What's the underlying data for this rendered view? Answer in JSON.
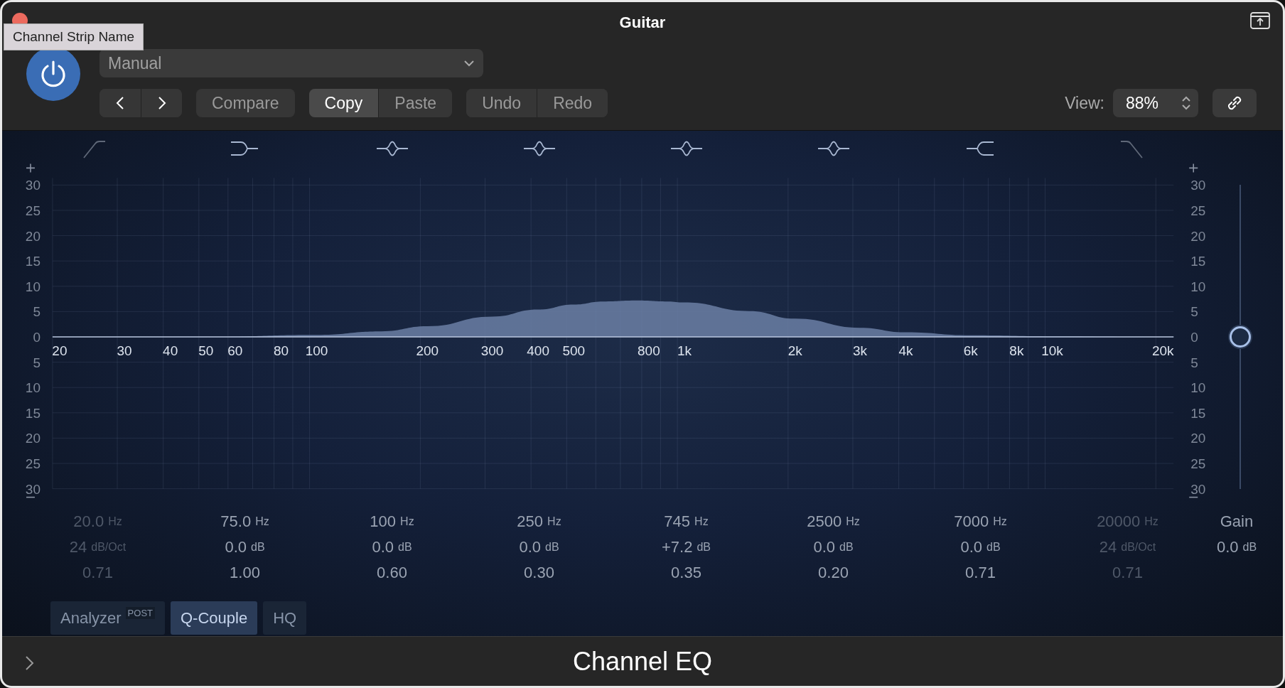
{
  "window": {
    "title": "Guitar"
  },
  "tooltip": "Channel Strip Name",
  "power": {
    "on": true
  },
  "preset": {
    "value": "Manual"
  },
  "nav": [
    {
      "kind": "back"
    },
    {
      "kind": "forward"
    }
  ],
  "compare": {
    "label": "Compare"
  },
  "clipboard": [
    {
      "label": "Copy",
      "selected": true
    },
    {
      "label": "Paste",
      "selected": false
    }
  ],
  "history": [
    {
      "label": "Undo"
    },
    {
      "label": "Redo"
    }
  ],
  "view": {
    "label": "View:",
    "value": "88%"
  },
  "bands": [
    {
      "kind": "lowcut",
      "enabled": false,
      "freq": "20.0",
      "freq_unit": "Hz",
      "gain": "24",
      "gain_unit": "dB/Oct",
      "q": "0.71"
    },
    {
      "kind": "lowshelf",
      "enabled": true,
      "freq": "75.0",
      "freq_unit": "Hz",
      "gain": "0.0",
      "gain_unit": "dB",
      "q": "1.00"
    },
    {
      "kind": "bell",
      "enabled": true,
      "freq": "100",
      "freq_unit": "Hz",
      "gain": "0.0",
      "gain_unit": "dB",
      "q": "0.60"
    },
    {
      "kind": "bell",
      "enabled": true,
      "freq": "250",
      "freq_unit": "Hz",
      "gain": "0.0",
      "gain_unit": "dB",
      "q": "0.30"
    },
    {
      "kind": "bell",
      "enabled": true,
      "freq": "745",
      "freq_unit": "Hz",
      "gain": "+7.2",
      "gain_unit": "dB",
      "q": "0.35"
    },
    {
      "kind": "bell",
      "enabled": true,
      "freq": "2500",
      "freq_unit": "Hz",
      "gain": "0.0",
      "gain_unit": "dB",
      "q": "0.20"
    },
    {
      "kind": "highshelf",
      "enabled": true,
      "freq": "7000",
      "freq_unit": "Hz",
      "gain": "0.0",
      "gain_unit": "dB",
      "q": "0.71"
    },
    {
      "kind": "highcut",
      "enabled": false,
      "freq": "20000",
      "freq_unit": "Hz",
      "gain": "24",
      "gain_unit": "dB/Oct",
      "q": "0.71"
    }
  ],
  "graph": {
    "frequency_labels": [
      "20",
      "30",
      "40",
      "50",
      "60",
      "80",
      "100",
      "200",
      "300",
      "400",
      "500",
      "800",
      "1k",
      "2k",
      "3k",
      "4k",
      "6k",
      "8k",
      "10k",
      "20k"
    ],
    "left_axis_labels": [
      "30",
      "25",
      "20",
      "15",
      "10",
      "5",
      "0",
      "5",
      "10",
      "15",
      "20",
      "25",
      "30"
    ],
    "right_axis_labels": [
      "30",
      "25",
      "20",
      "15",
      "10",
      "5",
      "0",
      "5",
      "10",
      "15",
      "20",
      "25",
      "30"
    ]
  },
  "gain": {
    "label": "Gain",
    "value": "0.0",
    "unit": "dB",
    "level": 0.5
  },
  "options": [
    {
      "label": "Analyzer",
      "badge": "POST",
      "on": false
    },
    {
      "label": "Q-Couple",
      "on": true
    },
    {
      "label": "HQ",
      "on": false
    }
  ],
  "footer": {
    "title": "Channel EQ"
  }
}
